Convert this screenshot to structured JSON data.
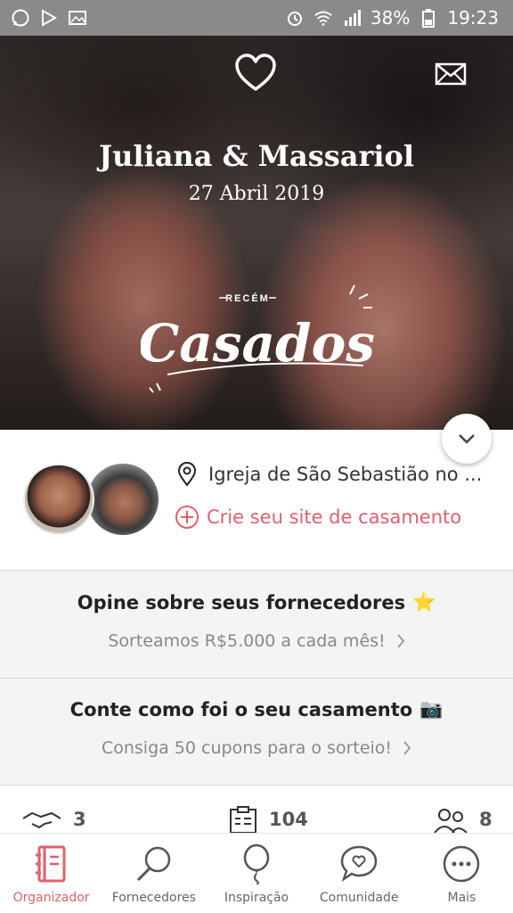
{
  "status_bar": {
    "battery": "38%",
    "time": "19:23"
  },
  "hero": {
    "title": "Juliana & Massariol",
    "date": "27 Abril 2019",
    "badge_small": "RECÉM",
    "badge_big": "Casados"
  },
  "profile": {
    "location": "Igreja de São Sebastião no ...",
    "create_site": "Crie seu site de casamento"
  },
  "cards": [
    {
      "title": "Opine sobre seus fornecedores",
      "icon": "⭐",
      "subtitle": "Sorteamos R$5.000 a cada mês!"
    },
    {
      "title": "Conte como foi o seu casamento",
      "icon": "📷",
      "subtitle": "Consiga 50 cupons para o sorteio!"
    }
  ],
  "stats": [
    {
      "icon": "handshake-icon",
      "value": "3"
    },
    {
      "icon": "checklist-icon",
      "value": "104"
    },
    {
      "icon": "guests-icon",
      "value": "8"
    }
  ],
  "nav": [
    {
      "label": "Organizador",
      "icon": "notebook-icon",
      "active": true
    },
    {
      "label": "Fornecedores",
      "icon": "search-icon",
      "active": false
    },
    {
      "label": "Inspiração",
      "icon": "balloon-icon",
      "active": false
    },
    {
      "label": "Comunidade",
      "icon": "chat-heart-icon",
      "active": false
    },
    {
      "label": "Mais",
      "icon": "more-icon",
      "active": false
    }
  ],
  "colors": {
    "accent": "#e0606b",
    "status_bar": "#8a8a8a"
  }
}
